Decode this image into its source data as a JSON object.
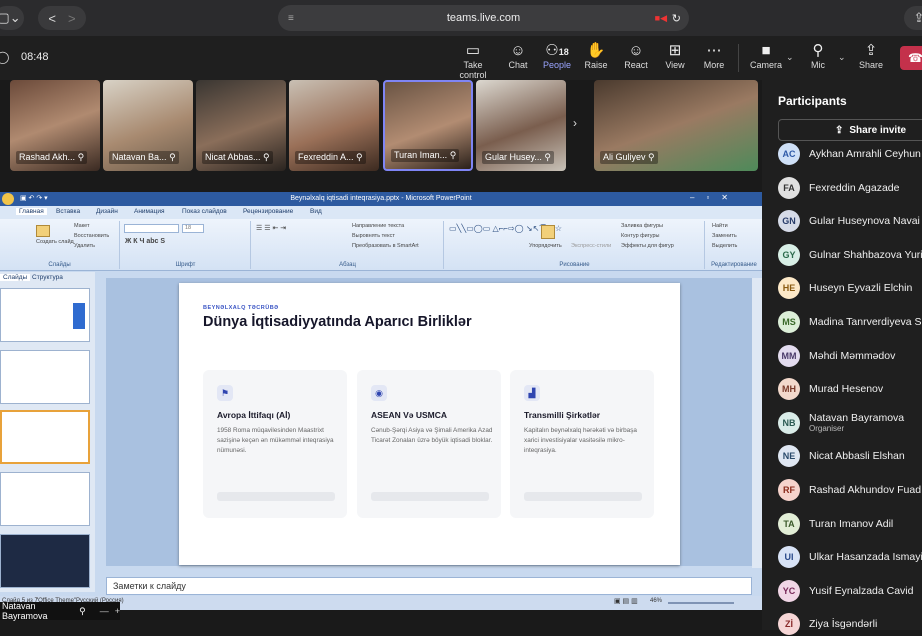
{
  "browser": {
    "url": "teams.live.com",
    "back": "<",
    "forward": ">"
  },
  "meeting": {
    "time": "08:48",
    "toolbar": [
      {
        "label": "Take control",
        "icon": "take-control-icon",
        "glyph": "▭"
      },
      {
        "label": "Chat",
        "icon": "chat-icon",
        "glyph": "☺"
      },
      {
        "label": "People",
        "icon": "people-icon",
        "glyph": "⚇",
        "count": "18"
      },
      {
        "label": "Raise",
        "icon": "raise-hand-icon",
        "glyph": "✋"
      },
      {
        "label": "React",
        "icon": "react-icon",
        "glyph": "☺"
      },
      {
        "label": "View",
        "icon": "view-icon",
        "glyph": "⊞"
      },
      {
        "label": "More",
        "icon": "more-icon",
        "glyph": "⋯"
      },
      {
        "label": "Camera",
        "icon": "camera-icon",
        "glyph": "■"
      },
      {
        "label": "Mic",
        "icon": "mic-icon",
        "glyph": "⚲"
      },
      {
        "label": "Share",
        "icon": "share-icon",
        "glyph": "⇪"
      }
    ],
    "video_tiles": [
      "Rashad Akh...",
      "Natavan Ba...",
      "Nicat Abbas...",
      "Fexreddin A...",
      "Turan Iman...",
      "Gular Husey..."
    ],
    "active_speaker": "Ali Guliyev",
    "self_name": "Natavan Bayramova"
  },
  "participants": {
    "title": "Participants",
    "share_invite": "Share invite",
    "list": [
      {
        "initials": "AC",
        "name": "Aykhan Amrahli Ceyhun",
        "sub": ""
      },
      {
        "initials": "FA",
        "name": "Fexreddin Agazade",
        "sub": ""
      },
      {
        "initials": "GN",
        "name": "Gular Huseynova Navai",
        "sub": ""
      },
      {
        "initials": "GY",
        "name": "Gulnar Shahbazova Yurik",
        "sub": ""
      },
      {
        "initials": "HE",
        "name": "Huseyn Eyvazli Elchin",
        "sub": ""
      },
      {
        "initials": "MS",
        "name": "Madina Tanrverdiyeva Sh",
        "sub": ""
      },
      {
        "initials": "MM",
        "name": "Məhdi Məmmədov",
        "sub": ""
      },
      {
        "initials": "MH",
        "name": "Murad Hesenov",
        "sub": ""
      },
      {
        "initials": "NB",
        "name": "Natavan Bayramova",
        "sub": "Organiser"
      },
      {
        "initials": "NE",
        "name": "Nicat Abbasli Elshan",
        "sub": ""
      },
      {
        "initials": "RF",
        "name": "Rashad Akhundov Fuad",
        "sub": ""
      },
      {
        "initials": "TA",
        "name": "Turan Imanov Adil",
        "sub": ""
      },
      {
        "initials": "UI",
        "name": "Ulkar Hasanzada Ismayil",
        "sub": ""
      },
      {
        "initials": "YC",
        "name": "Yusif Eynalzada Cavid",
        "sub": ""
      },
      {
        "initials": "Zİ",
        "name": "Ziya İsgəndərli",
        "sub": ""
      }
    ]
  },
  "ppt": {
    "window_title": "Beynəlxalq iqtisadi inteqrasiya.pptx - Microsoft PowerPoint",
    "tabs": [
      "Главная",
      "Вставка",
      "Дизайн",
      "Анимация",
      "Показ слайдов",
      "Рецензирование",
      "Вид"
    ],
    "groups": [
      "Слайды",
      "Шрифт",
      "Абзац",
      "Рисование",
      "Редактирование"
    ],
    "panel_tabs": [
      "Слайды",
      "Структура"
    ],
    "notes_placeholder": "Заметки к слайду",
    "status_left": "Слайд 5 из 7",
    "status_theme": "\"Office Theme\"",
    "status_lang": "Русский (Россия)",
    "zoom": "46%",
    "ribbon_labels": {
      "create": "Создать слайд",
      "layout": "Макет",
      "restore": "Восстановить",
      "delete": "Удалить",
      "text_dir": "Направление текста",
      "align_text": "Выровнять текст",
      "smartart": "Преобразовать в SmartArt",
      "arrange": "Упорядочить",
      "quick_styles": "Экспресс-стили",
      "fill": "Заливка фигуры",
      "outline": "Контур фигуры",
      "effects": "Эффекты для фигур",
      "find": "Найти",
      "replace": "Заменить",
      "select": "Выделить",
      "font_size": "18"
    }
  },
  "slide": {
    "eyebrow": "BEYNƏLXALQ TƏCRÜBƏ",
    "title": "Dünya İqtisadiyyatında Aparıcı Birliklər",
    "cards": [
      {
        "icon": "flag-icon",
        "glyph": "⚑",
        "title": "Avropa İttifaqı (Aİ)",
        "desc": "1958 Roma müqavilesinden Maastrixt sazişinə keçən ən mükəmməl inteqrasiya nümunəsi."
      },
      {
        "icon": "globe-icon",
        "glyph": "◉",
        "title": "ASEAN Və USMCA",
        "desc": "Cənub-Şərqi Asiya və Şimali Amerika Azad Ticarət Zonaları üzrə böyük iqtisadi bloklar."
      },
      {
        "icon": "chart-icon",
        "glyph": "▟",
        "title": "Transmilli Şirkətlər",
        "desc": "Kapitalın beynəlxalq hərəkəti və birbaşa xarici investisiyalar vasitəsilə mikro-inteqrasiya."
      }
    ]
  }
}
